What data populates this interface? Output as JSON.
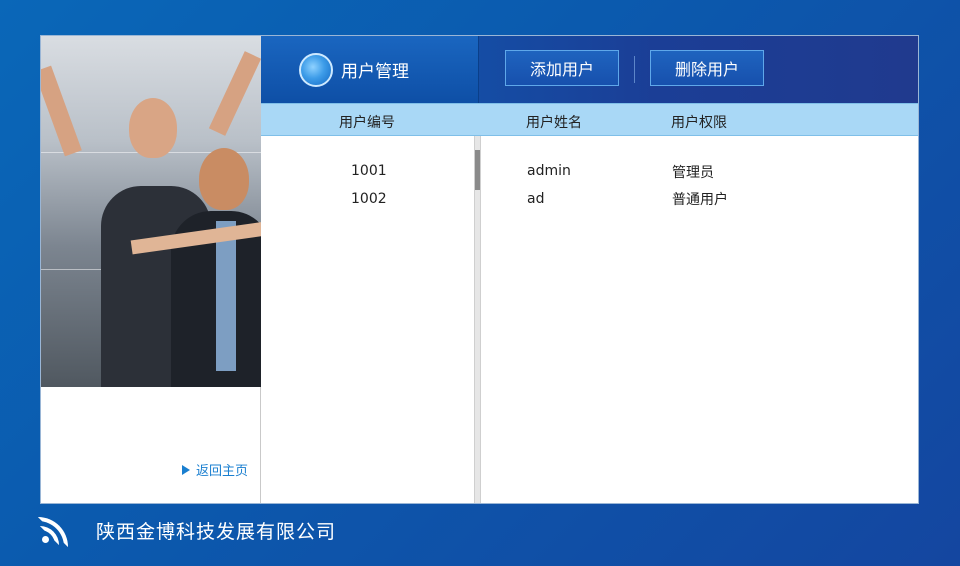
{
  "header": {
    "title": "用户管理",
    "add_label": "添加用户",
    "delete_label": "删除用户"
  },
  "columns": {
    "id": "用户编号",
    "name": "用户姓名",
    "role": "用户权限"
  },
  "users": [
    {
      "id": "1001",
      "name": "admin",
      "role": "管理员"
    },
    {
      "id": "1002",
      "name": "ad",
      "role": "普通用户"
    }
  ],
  "sidebar": {
    "back_label": "返回主页"
  },
  "footer": {
    "company": "陕西金博科技发展有限公司"
  },
  "colors": {
    "accent": "#1a7fd0",
    "header_bg": "#1b3e96",
    "column_header_bg": "#a9d8f6"
  }
}
